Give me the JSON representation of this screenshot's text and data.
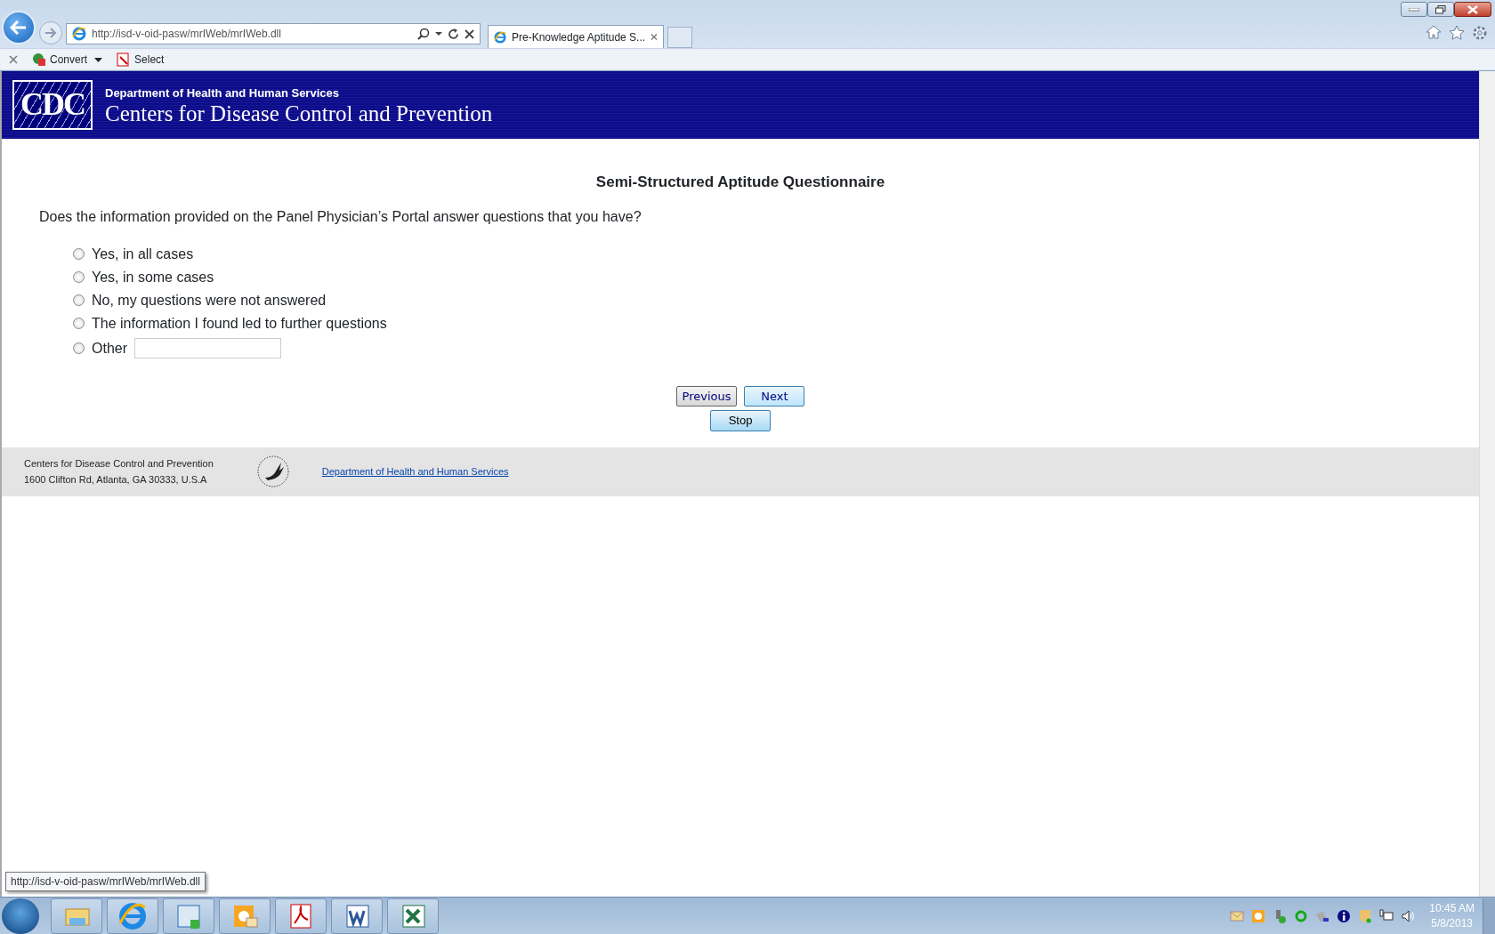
{
  "browser": {
    "address": "http://isd-v-oid-pasw/mrIWeb/mrIWeb.dll",
    "tab_title": "Pre-Knowledge Aptitude S...",
    "toolbar": [
      {
        "kind": "convert",
        "label": "Convert"
      },
      {
        "kind": "select",
        "label": "Select"
      }
    ]
  },
  "header": {
    "logo_text": "CDC",
    "department": "Department of Health and Human Services",
    "agency": "Centers for Disease Control and Prevention"
  },
  "survey": {
    "title": "Semi-Structured Aptitude Questionnaire",
    "question": "Does the information provided on the Panel Physician’s Portal answer questions that you have?",
    "options": [
      {
        "kind": "plain",
        "label": "Yes, in all cases",
        "selected": false
      },
      {
        "kind": "plain",
        "label": "Yes, in some cases",
        "selected": false
      },
      {
        "kind": "plain",
        "label": "No, my questions were not answered",
        "selected": false
      },
      {
        "kind": "plain",
        "label": "The information I found led to further questions",
        "selected": false
      },
      {
        "kind": "other",
        "label": "Other",
        "selected": false
      }
    ],
    "buttons": [
      {
        "kind": "previous",
        "label": "Previous"
      },
      {
        "kind": "next",
        "label": "Next"
      },
      {
        "kind": "stop",
        "label": "Stop"
      }
    ]
  },
  "footer": {
    "name": "Centers for Disease Control and Prevention",
    "address": "1600 Clifton Rd, Atlanta, GA 30333, U.S.A",
    "link": "Department of Health and Human Services"
  },
  "status_tooltip": "http://isd-v-oid-pasw/mrIWeb/mrIWeb.dll",
  "taskbar": {
    "items": [
      {
        "kind": "folder"
      },
      {
        "kind": "ie"
      },
      {
        "kind": "lync"
      },
      {
        "kind": "outlook"
      },
      {
        "kind": "pdf"
      },
      {
        "kind": "word"
      },
      {
        "kind": "excel"
      }
    ],
    "time": "10:45 AM",
    "date": "5/8/2013"
  }
}
